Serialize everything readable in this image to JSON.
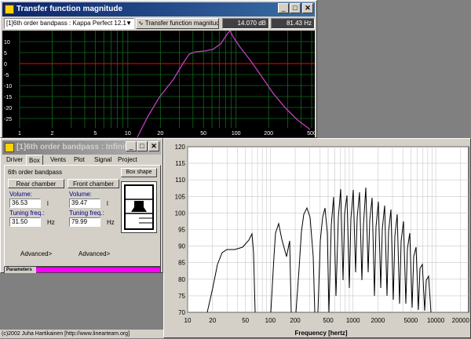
{
  "tf_window": {
    "title": "Transfer function magnitude",
    "project_select": "[1]6th order bandpass : Kappa Perfect 12.1",
    "view_select": "Transfer function magnitude",
    "readout_db": "14.070 dB",
    "readout_hz": "81.43 Hz",
    "y_ticks": [
      "10",
      "5",
      "0",
      "-5",
      "-10",
      "-15",
      "-20",
      "-25"
    ],
    "x_ticks": [
      "1",
      "2",
      "5",
      "10",
      "20",
      "50",
      "100",
      "200",
      "500"
    ]
  },
  "box_window": {
    "title": "[1]6th order bandpass : Infinit...",
    "tabs": [
      "Driver",
      "Box",
      "Vents",
      "Plot",
      "Signal",
      "Project"
    ],
    "active_tab": "Box",
    "box_type": "6th order bandpass",
    "change_button": "Box shape",
    "rear_chamber": {
      "header": "Rear chamber",
      "volume_label": "Volume:",
      "volume_value": "36.53",
      "volume_unit": "l",
      "tuning_label": "Tuning freq.:",
      "tuning_value": "31.50",
      "tuning_unit": "Hz",
      "advanced": "Advanced>"
    },
    "front_chamber": {
      "header": "Front chamber",
      "volume_label": "Volume:",
      "volume_value": "39.47",
      "volume_unit": "l",
      "tuning_label": "Tuning freq.:",
      "tuning_value": "79.99",
      "tuning_unit": "Hz",
      "advanced": "Advanced>"
    },
    "parameters_label": "Parameters"
  },
  "freq_window": {
    "y_ticks": [
      "120",
      "115",
      "110",
      "105",
      "100",
      "95",
      "90",
      "85",
      "80",
      "75",
      "70"
    ],
    "x_ticks": [
      "10",
      "20",
      "50",
      "100",
      "200",
      "500",
      "1000",
      "2000",
      "5000",
      "10000",
      "20000"
    ],
    "xlabel": "Frequency [hertz]"
  },
  "footer": {
    "copyright": "(c)2002 Juha Hartikainen [http://www.linearteam.org]"
  },
  "colors": {
    "plot_bg": "#000000",
    "grid": "#0f6b1f",
    "zero_line": "#ff0000",
    "curve": "#c040c0",
    "parameters_bar": "#ff00ff",
    "title_active": "#0a246a"
  }
}
